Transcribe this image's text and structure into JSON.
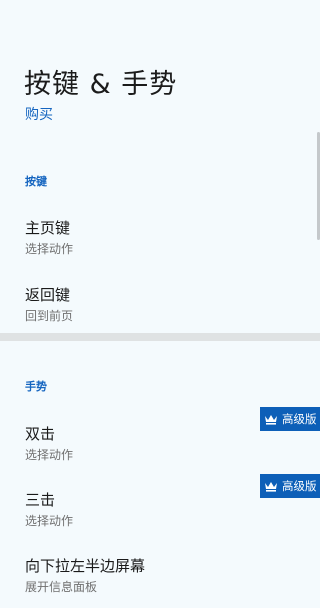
{
  "header": {
    "title": "按键 & 手势",
    "buy_label": "购买"
  },
  "sections": {
    "keys": {
      "header": "按键",
      "items": [
        {
          "title": "主页键",
          "subtitle": "选择动作"
        },
        {
          "title": "返回键",
          "subtitle": "回到前页"
        }
      ]
    },
    "gestures": {
      "header": "手势",
      "items": [
        {
          "title": "双击",
          "subtitle": "选择动作",
          "badge": "高级版"
        },
        {
          "title": "三击",
          "subtitle": "选择动作",
          "badge": "高级版"
        },
        {
          "title": "向下拉左半边屏幕",
          "subtitle": "展开信息面板"
        }
      ]
    }
  },
  "colors": {
    "accent": "#1565c0",
    "badge_bg": "#0d5fb8",
    "background": "#f4fafd",
    "divider": "#dfe2e3"
  },
  "icons": {
    "badge": "crown-icon"
  }
}
